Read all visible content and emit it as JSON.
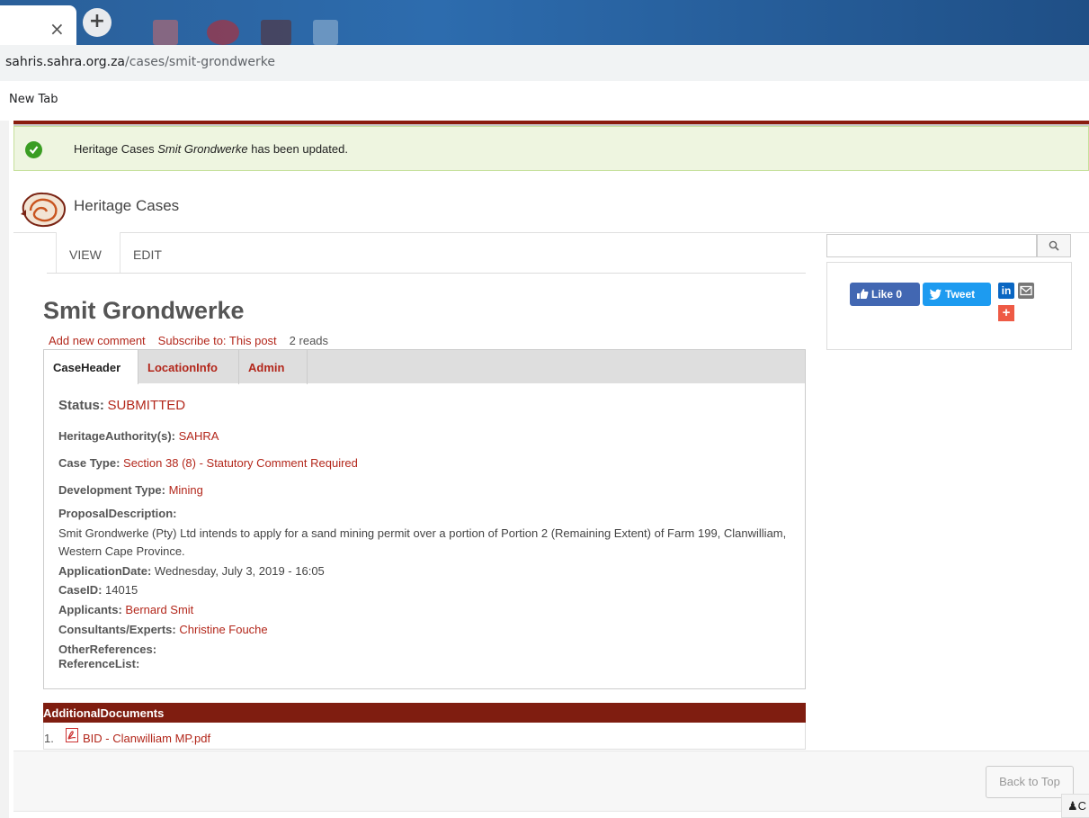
{
  "browser": {
    "close_glyph": "×",
    "newtab_glyph": "+",
    "url_host": "sahris.sahra.org.za",
    "url_path": "/cases/smit-grondwerke",
    "bookmark": "New Tab"
  },
  "alert": {
    "prefix": "Heritage Cases ",
    "name": "Smit Grondwerke",
    "suffix": " has been updated."
  },
  "site": {
    "brand": "Heritage Cases"
  },
  "tabs": {
    "view": "VIEW",
    "edit": "EDIT"
  },
  "node": {
    "title": "Smit Grondwerke",
    "links": {
      "comment": "Add new comment",
      "subscribe": "Subscribe to: This post",
      "reads": "2 reads"
    }
  },
  "groups": {
    "caseheader": "CaseHeader",
    "location": "LocationInfo",
    "admin": "Admin"
  },
  "fields": {
    "status_label": "Status:",
    "status_value": "SUBMITTED",
    "authority_label": "HeritageAuthority(s):",
    "authority_value": "SAHRA",
    "casetype_label": "Case Type:",
    "casetype_value": "Section 38 (8) - Statutory Comment Required",
    "devtype_label": "Development Type:",
    "devtype_value": "Mining",
    "proposal_label": "ProposalDescription:",
    "proposal_value": "Smit Grondwerke (Pty) Ltd intends to apply for a sand mining permit over a portion of Portion 2 (Remaining Extent) of Farm 199, Clanwilliam, Western Cape Province.",
    "appdate_label": "ApplicationDate:",
    "appdate_value": "Wednesday, July 3, 2019 - 16:05",
    "caseid_label": "CaseID:",
    "caseid_value": "14015",
    "applicants_label": "Applicants:",
    "applicants_value": "Bernard Smit",
    "consultants_label": "Consultants/Experts:",
    "consultants_value": "Christine Fouche",
    "otherrefs_label": "OtherReferences:",
    "reflist_label": "ReferenceList:"
  },
  "documents": {
    "header": "AdditionalDocuments",
    "items": [
      {
        "num": "1.",
        "name": "BID - Clanwilliam MP.pdf"
      }
    ]
  },
  "share": {
    "like": "Like 0",
    "tweet": "Tweet",
    "linkedin": "in",
    "plus": "+"
  },
  "footer": {
    "back_to_top": "Back to Top",
    "chat": "C"
  },
  "colors": {
    "accent": "#b3271b",
    "header_bar": "#7f1d10",
    "alert_bg": "#eef5e0"
  }
}
